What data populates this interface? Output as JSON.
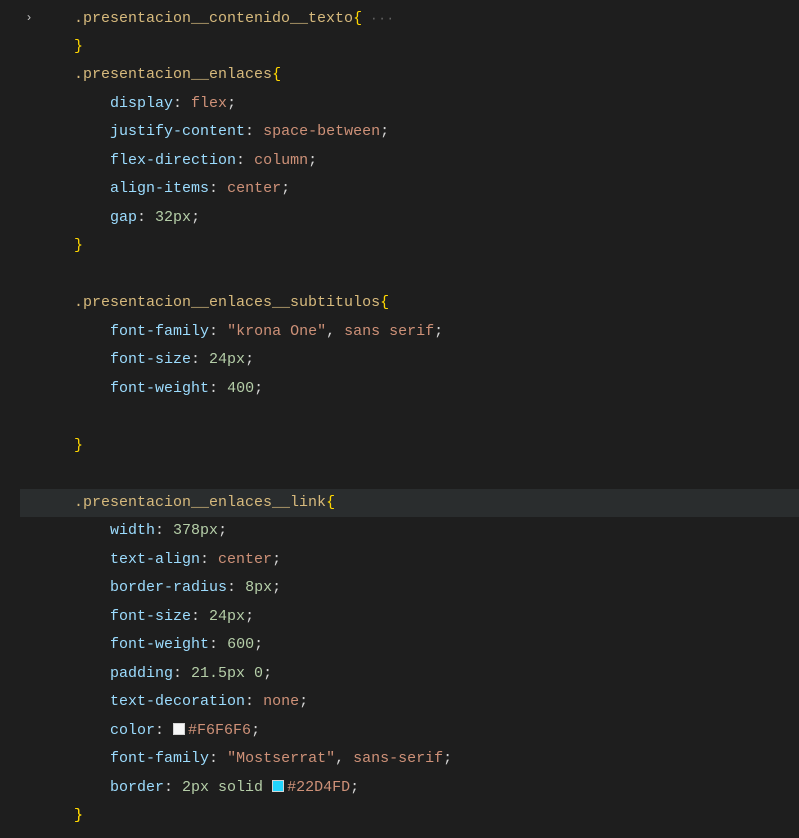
{
  "rules": [
    {
      "selector": ".presentacion__contenido__texto",
      "folded": true,
      "close_brace": true
    },
    {
      "selector": ".presentacion__enlaces",
      "decls": [
        {
          "prop": "display",
          "value": "flex",
          "type": "ident"
        },
        {
          "prop": "justify-content",
          "value": "space-between",
          "type": "ident"
        },
        {
          "prop": "flex-direction",
          "value": "column",
          "type": "ident"
        },
        {
          "prop": "align-items",
          "value": "center",
          "type": "ident"
        },
        {
          "prop": "gap",
          "value": "32px",
          "type": "number"
        }
      ]
    },
    {
      "blank_before": true,
      "selector": ".presentacion__enlaces__subtitulos",
      "decls": [
        {
          "prop": "font-family",
          "value_parts": [
            {
              "t": "string",
              "v": "\"krona One\""
            },
            {
              "t": "punct",
              "v": ", "
            },
            {
              "t": "ident",
              "v": "sans serif"
            }
          ]
        },
        {
          "prop": "font-size",
          "value": "24px",
          "type": "number"
        },
        {
          "prop": "font-weight",
          "value": "400",
          "type": "number"
        }
      ],
      "blank_inside_after": true
    },
    {
      "blank_before": true,
      "selector": ".presentacion__enlaces__link",
      "current": true,
      "decls": [
        {
          "prop": "width",
          "value": "378px",
          "type": "number"
        },
        {
          "prop": "text-align",
          "value": "center",
          "type": "ident"
        },
        {
          "prop": "border-radius",
          "value": "8px",
          "type": "number"
        },
        {
          "prop": "font-size",
          "value": "24px",
          "type": "number"
        },
        {
          "prop": "font-weight",
          "value": "600",
          "type": "number"
        },
        {
          "prop": "padding",
          "value": "21.5px 0",
          "type": "number"
        },
        {
          "prop": "text-decoration",
          "value": "none",
          "type": "ident"
        },
        {
          "prop": "color",
          "color": "#F6F6F6"
        },
        {
          "prop": "font-family",
          "value_parts": [
            {
              "t": "string",
              "v": "\"Mostserrat\""
            },
            {
              "t": "punct",
              "v": ", "
            },
            {
              "t": "ident",
              "v": "sans-serif"
            }
          ]
        },
        {
          "prop": "border",
          "border_parts": {
            "pre": "2px solid ",
            "color": "#22D4FD"
          }
        }
      ]
    }
  ],
  "colors": {
    "selector": "#d7ba7d",
    "brace": "#ffd700",
    "prop": "#9cdcfe",
    "ident": "#ce9178",
    "number": "#b5cea8",
    "string": "#ce9178",
    "punct": "#d4d4d4"
  }
}
